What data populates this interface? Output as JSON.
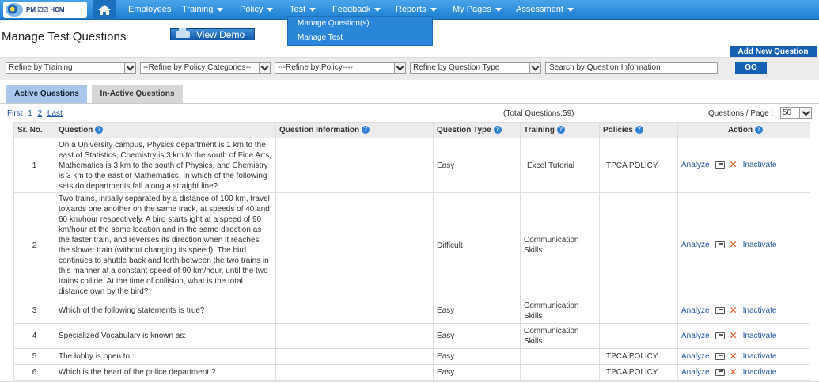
{
  "nav": {
    "logo_text": "PM ⚂⚂ HCM",
    "items": [
      {
        "label": "Employees",
        "has_caret": false
      },
      {
        "label": "Training",
        "has_caret": true
      },
      {
        "label": "Policy",
        "has_caret": true
      },
      {
        "label": "Test",
        "has_caret": true
      },
      {
        "label": "Feedback",
        "has_caret": true
      },
      {
        "label": "Reports",
        "has_caret": true
      },
      {
        "label": "My Pages",
        "has_caret": true
      },
      {
        "label": "Assessment",
        "has_caret": true
      }
    ],
    "test_menu": [
      "Manage Question(s)",
      "Manage Test"
    ]
  },
  "page": {
    "title": "Manage Test Questions",
    "view_demo": "View Demo",
    "add_new_question": "Add New Question"
  },
  "filters": {
    "training": "Refine by Training",
    "policy_categories": "--Refine by Policy Categories--",
    "policy": "---Refine by Policy----",
    "question_type": "Refine by Question Type",
    "search_placeholder": "Search by Question Information",
    "go": "GO"
  },
  "tabs": {
    "active": "Active Questions",
    "inactive": "In-Active Questions"
  },
  "pager": {
    "first": "First",
    "page1": "1",
    "page2": "2",
    "last": "Last",
    "total": "(Total Questions:59)",
    "per_page_label": "Questions / Page :",
    "per_page_value": "50"
  },
  "table": {
    "headers": {
      "sr": "Sr. No.",
      "question": "Question",
      "info": "Question Information",
      "type": "Question Type",
      "training": "Training",
      "policies": "Policies",
      "action": "Action"
    },
    "action_labels": {
      "analyze": "Analyze",
      "inactivate": "Inactivate"
    },
    "rows": [
      {
        "sr": "1",
        "question": "On a University campus, Physics department is 1 km to the east of Statistics, Chemistry is 3 km to the south of Fine Arts, Mathematics is 3 km to the south of Physics, and Chemistry is 3 km to the east of Mathematics. In which of the following sets do departments fall along a straight line?",
        "info": "",
        "type": "Easy",
        "training": "Excel Tutorial",
        "policies": "TPCA POLICY"
      },
      {
        "sr": "2",
        "question": "Two trains, initially separated by a distance of 100 km, travel towards one another on the same track, at speeds of 40 and 60 km/hour respectively. A bird starts ight at a speed of 90 km/hour at the same location and in the same direction as the faster train, and reverses its direction when it reaches the slower train (without changing its speed). The bird continues to shuttle back and forth between the two trains in this manner at a constant speed of 90 km/hour, until the two trains collide. At the time of collision, what is the total distance own by the bird?",
        "info": "",
        "type": "Difficult",
        "training": "Communication Skills",
        "policies": ""
      },
      {
        "sr": "3",
        "question": "Which of the following statements is true?",
        "info": "",
        "type": "Easy",
        "training": "Communication Skills",
        "policies": ""
      },
      {
        "sr": "4",
        "question": "Specialized Vocabulary is known as:",
        "info": "",
        "type": "Easy",
        "training": "Communication Skills",
        "policies": ""
      },
      {
        "sr": "5",
        "question": "The lobby is open to :",
        "info": "",
        "type": "Easy",
        "training": "",
        "policies": "TPCA POLICY"
      },
      {
        "sr": "6",
        "question": "Which is the heart of the police department ?",
        "info": "",
        "type": "Easy",
        "training": "",
        "policies": "TPCA POLICY"
      }
    ]
  }
}
